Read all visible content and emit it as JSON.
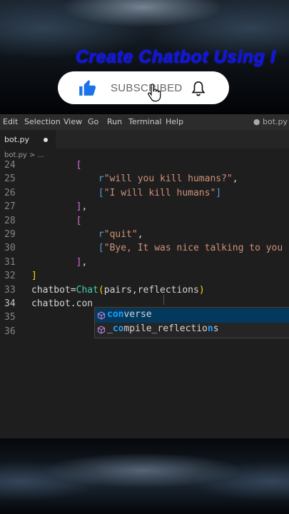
{
  "overlay": {
    "headline": "Create Chatbot Using I",
    "subscribe_label": "SUBSCRIBED"
  },
  "menubar": {
    "items": [
      "Edit",
      "Selection",
      "View",
      "Go",
      "Run",
      "Terminal",
      "Help"
    ],
    "open_file": "● bot.py"
  },
  "tab": {
    "name": "bot.py"
  },
  "breadcrumb": "bot.py > ...",
  "code_lines": [
    {
      "n": "24",
      "segments": [
        {
          "t": "        ",
          "c": ""
        },
        {
          "t": "[",
          "c": "p"
        }
      ]
    },
    {
      "n": "25",
      "segments": [
        {
          "t": "            ",
          "c": ""
        },
        {
          "t": "r",
          "c": "k"
        },
        {
          "t": "\"will you kill humans?\"",
          "c": "s"
        },
        {
          "t": ",",
          "c": ""
        }
      ]
    },
    {
      "n": "26",
      "segments": [
        {
          "t": "            ",
          "c": ""
        },
        {
          "t": "[",
          "c": "k"
        },
        {
          "t": "\"I will kill humans\"",
          "c": "s"
        },
        {
          "t": "]",
          "c": "k"
        }
      ]
    },
    {
      "n": "27",
      "segments": [
        {
          "t": "        ",
          "c": ""
        },
        {
          "t": "]",
          "c": "p"
        },
        {
          "t": ",",
          "c": ""
        }
      ]
    },
    {
      "n": "28",
      "segments": [
        {
          "t": "        ",
          "c": ""
        },
        {
          "t": "[",
          "c": "p"
        }
      ]
    },
    {
      "n": "29",
      "segments": [
        {
          "t": "            ",
          "c": ""
        },
        {
          "t": "r",
          "c": "k"
        },
        {
          "t": "\"quit\"",
          "c": "s"
        },
        {
          "t": ",",
          "c": ""
        }
      ]
    },
    {
      "n": "30",
      "segments": [
        {
          "t": "            ",
          "c": ""
        },
        {
          "t": "[",
          "c": "k"
        },
        {
          "t": "\"Bye, It was nice talking to you :) \"",
          "c": "s"
        }
      ]
    },
    {
      "n": "31",
      "segments": [
        {
          "t": "        ",
          "c": ""
        },
        {
          "t": "]",
          "c": "p"
        },
        {
          "t": ",",
          "c": ""
        }
      ]
    },
    {
      "n": "32",
      "segments": [
        {
          "t": "]",
          "c": "y"
        }
      ]
    },
    {
      "n": "33",
      "segments": [
        {
          "t": "chatbot",
          "c": ""
        },
        {
          "t": "=",
          "c": ""
        },
        {
          "t": "Chat",
          "c": "fn"
        },
        {
          "t": "(",
          "c": "y"
        },
        {
          "t": "pairs,reflections",
          "c": ""
        },
        {
          "t": ")",
          "c": "y"
        }
      ]
    },
    {
      "n": "34",
      "segments": [
        {
          "t": "chatbot.con",
          "c": ""
        }
      ],
      "active": true
    },
    {
      "n": "35",
      "segments": []
    },
    {
      "n": "36",
      "segments": []
    }
  ],
  "suggestions": [
    {
      "match": "con",
      "rest": "verse",
      "selected": true
    },
    {
      "pre": "_",
      "match": "co",
      "mid": "mpile_reflectio",
      "match2": "n",
      "rest": "s",
      "selected": false
    }
  ],
  "colors": {
    "editor_bg": "#1e1e1e",
    "headline": "#1414e0",
    "selection": "#04395e",
    "string": "#ce9178"
  }
}
